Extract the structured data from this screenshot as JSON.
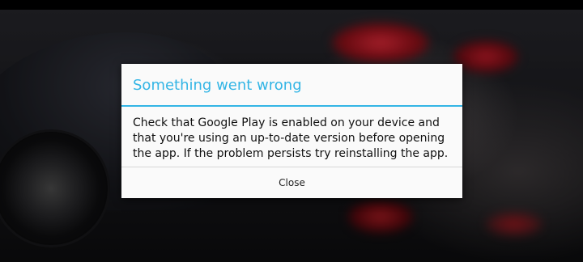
{
  "dialog": {
    "title": "Something went wrong",
    "message": "Check that Google Play is enabled on your device and that you're using an up-to-date version before opening the app. If the problem persists try reinstalling the app.",
    "close_label": "Close",
    "accent_color": "#33b5e5"
  }
}
